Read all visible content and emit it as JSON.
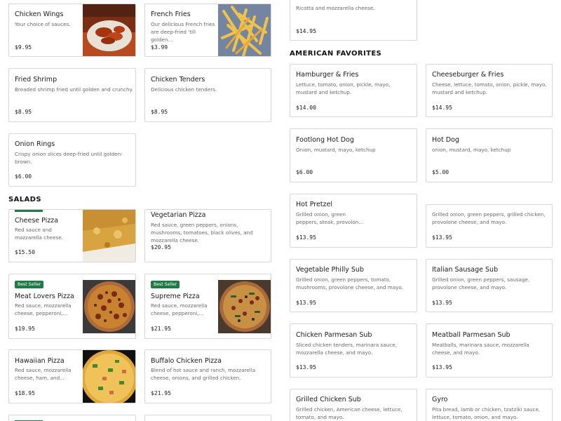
{
  "left": {
    "top_items": [
      {
        "name": "Chicken Wings",
        "desc": "Your choice of sauces.",
        "price": "$9.95",
        "image": "chicken-wings"
      },
      {
        "name": "French Fries",
        "desc": "Our delicious French fries are deep-fried 'till golden...",
        "price": "$3.99",
        "image": "french-fries"
      },
      {
        "name": "Fried Shrimp",
        "desc": "Breaded shrimp fried until golden and crunchy.",
        "price": "$8.95"
      },
      {
        "name": "Chicken Tenders",
        "desc": "Delicious chicken tenders.",
        "price": "$8.95"
      },
      {
        "name": "Onion Rings",
        "desc": "Crispy onion slices deep-fried until golden-brown.",
        "price": "$6.00"
      }
    ],
    "salads_title": "SALADS",
    "pizzas": [
      {
        "name": "Cheese Pizza",
        "desc": "Red sauce and mozzarella cheese.",
        "price": "$15.50",
        "image": "cheese-pizza"
      },
      {
        "name": "Vegetarian Pizza",
        "desc": "Red sauce, green peppers, onions, mushrooms, tomatoes, black olives, and mozzarella cheese.",
        "price": "$20.95"
      },
      {
        "badge": "Best Seller",
        "name": "Meat Lovers Pizza",
        "desc": "Red sauce, mozzarella cheese, pepperoni,...",
        "price": "$19.95",
        "image": "meat-lovers-pizza"
      },
      {
        "badge": "Best Seller",
        "name": "Supreme Pizza",
        "desc": "Red sauce, mozzarella cheese, pepperoni,...",
        "price": "$21.95",
        "image": "supreme-pizza"
      },
      {
        "name": "Hawaiian Pizza",
        "desc": "Red sauce, mozzarella cheese, ham, and...",
        "price": "$18.95",
        "image": "hawaiian-pizza"
      },
      {
        "name": "Buffalo Chicken Pizza",
        "desc": "Blend of hot sauce and ranch, mozzarella cheese, onions, and grilled chicken.",
        "price": "$21.95"
      }
    ]
  },
  "right": {
    "top_partial": {
      "desc": "Ricotta and mozzarella cheese.",
      "price": "$14.95"
    },
    "american_title": "AMERICAN FAVORITES",
    "items": [
      {
        "name": "Hamburger & Fries",
        "desc": "Lettuce, tomato, onion, pickle, mayo, mustard and ketchup.",
        "price": "$14.00"
      },
      {
        "name": "Cheeseburger & Fries",
        "desc": "Cheese, lettuce, tomato, onion, pickle, mayo, mustard and ketchup.",
        "price": "$14.95"
      },
      {
        "name": "Footlong Hot Dog",
        "desc": "Onion, mustard, mayo, ketchup",
        "price": "$6.00"
      },
      {
        "name": "Hot Dog",
        "desc": "onion, mustard, mayo, ketchup",
        "price": "$5.00"
      },
      {
        "name": "Hot Pretzel",
        "desc": "Grilled onion, green peppers, steak, provolon...",
        "price": "$13.95"
      },
      {
        "desc": "Grilled onion, green peppers, grilled chicken, provolone cheese, and mayo.",
        "price": "$13.95"
      },
      {
        "name": "Vegetable Philly Sub",
        "desc": "Grilled onion, green peppers, tomato, mushrooms, provolone cheese, and mayo.",
        "price": "$13.95"
      },
      {
        "name": "Italian Sausage Sub",
        "desc": "Grilled onion, green peppers, sausage, provolone cheese, and mayo.",
        "price": "$13.95"
      },
      {
        "name": "Chicken Parmesan Sub",
        "desc": "Sliced chicken tenders, marinara sauce, mozzarella cheese, and mayo.",
        "price": "$13.95"
      },
      {
        "name": "Meatball Parmesan Sub",
        "desc": "Meatballs, marinara sauce, mozzarella cheese, and mayo.",
        "price": "$13.95"
      },
      {
        "name": "Grilled Chicken Sub",
        "desc": "Grilled chicken, American cheese, lettuce, tomato, and mayo."
      },
      {
        "name": "Gyro",
        "desc": "Pita bread, lamb or chicken, tzatziki sauce, lettuce, tomato, onion, and mayo."
      }
    ]
  }
}
